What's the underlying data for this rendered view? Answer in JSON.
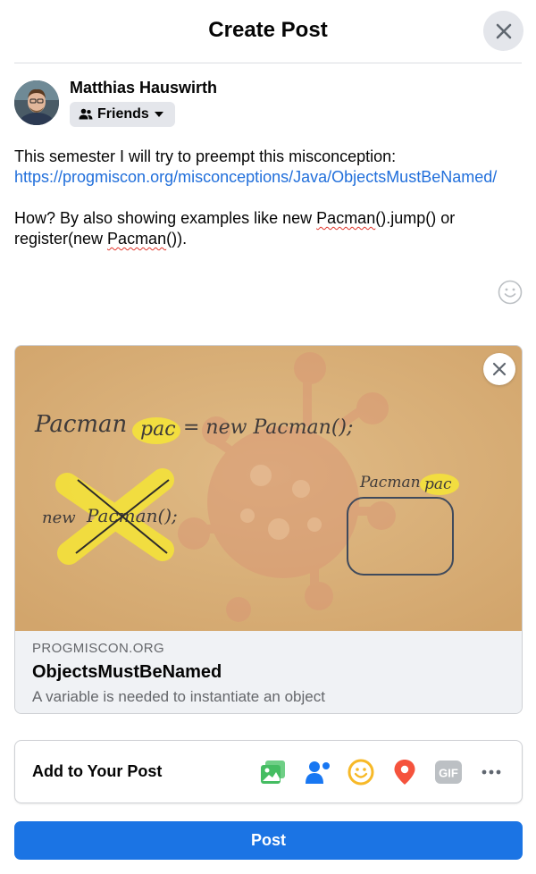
{
  "header": {
    "title": "Create Post"
  },
  "author": {
    "name": "Matthias Hauswirth",
    "audience_label": "Friends"
  },
  "post": {
    "line1": "This semester I will try to preempt this misconception:",
    "link": "https://progmiscon.org/misconceptions/Java/ObjectsMustBeNamed/",
    "line3_before": "How? By also showing examples like new ",
    "line3_pacman": "Pacman",
    "line3_after": "().jump() or",
    "line4_before": "register(new ",
    "line4_pacman": "Pacman",
    "line4_after": "())."
  },
  "preview": {
    "domain": "PROGMISCON.ORG",
    "title": "ObjectsMustBeNamed",
    "description": "A variable is needed to instantiate an object",
    "image_text": {
      "line1_left": "Pacman",
      "line1_var": "pac",
      "line1_right": "= new Pacman();",
      "crossed_new": "new",
      "crossed_call": "Pacman();",
      "box_type": "Pacman",
      "box_var": "pac"
    }
  },
  "add_to_post": {
    "label": "Add to Your Post",
    "icons": [
      "photo-video-icon",
      "tag-people-icon",
      "feeling-icon",
      "check-in-icon",
      "gif-icon",
      "more-icon"
    ],
    "gif_label": "GIF"
  },
  "actions": {
    "post_label": "Post"
  },
  "colors": {
    "primary": "#1b74e4",
    "link": "#216fdb",
    "secondary_text": "#65676b",
    "photo_green": "#45bd62",
    "tag_blue": "#1877f2",
    "feeling_yellow": "#f7b928",
    "checkin_red": "#f5533d",
    "gif_gray": "#bcc0c4"
  }
}
